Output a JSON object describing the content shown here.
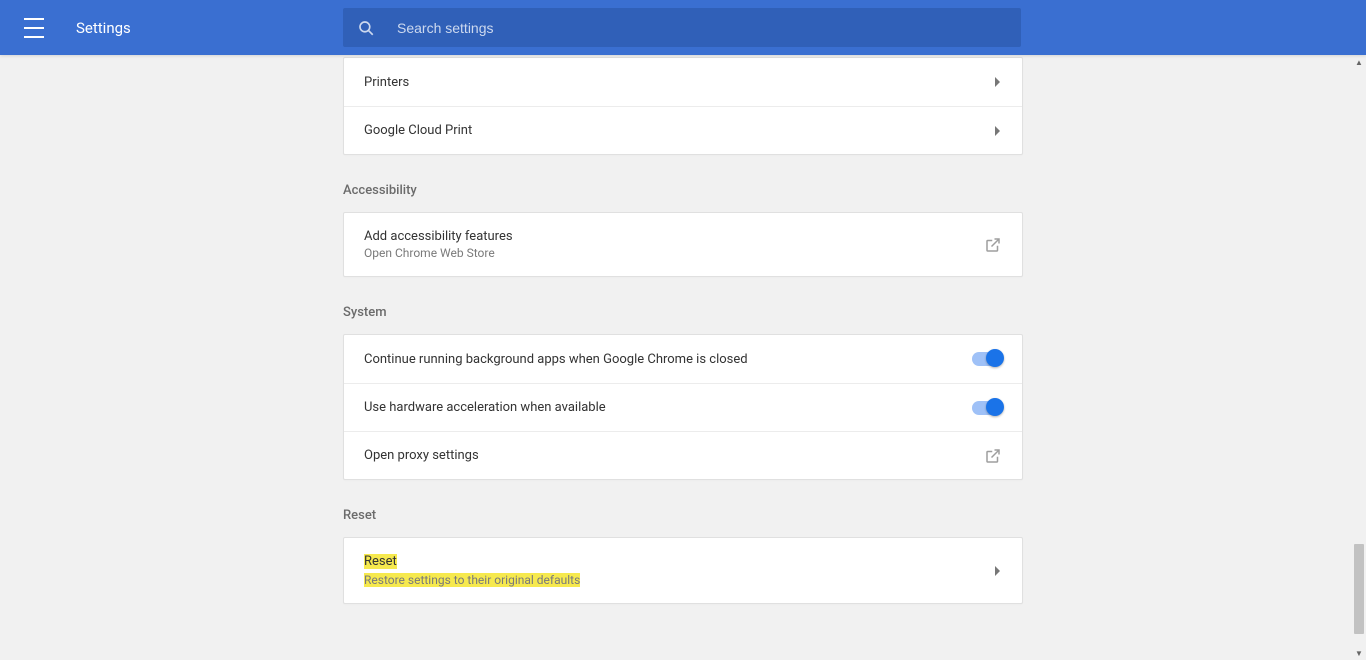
{
  "header": {
    "title": "Settings",
    "search_placeholder": "Search settings"
  },
  "printing": {
    "printers": "Printers",
    "gcp": "Google Cloud Print"
  },
  "accessibility": {
    "section": "Accessibility",
    "add_label": "Add accessibility features",
    "add_sub": "Open Chrome Web Store"
  },
  "system": {
    "section": "System",
    "bg_apps": "Continue running background apps when Google Chrome is closed",
    "hw_accel": "Use hardware acceleration when available",
    "proxy": "Open proxy settings"
  },
  "reset": {
    "section": "Reset",
    "label": "Reset",
    "sub": "Restore settings to their original defaults"
  }
}
